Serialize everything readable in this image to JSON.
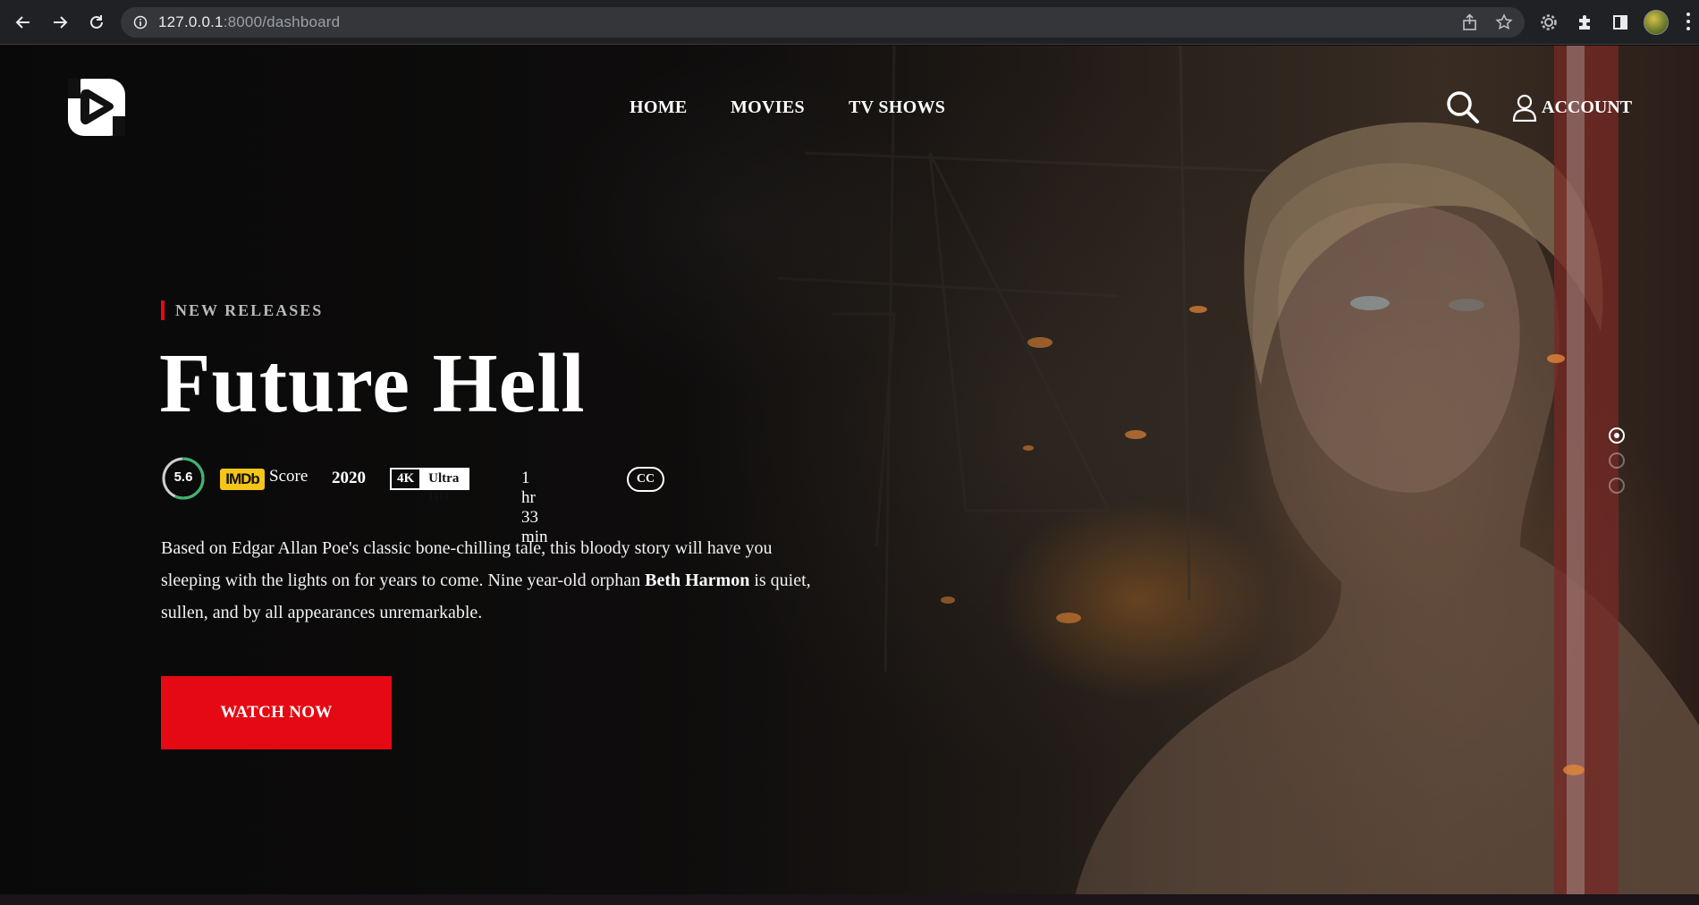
{
  "browser": {
    "url_host": "127.0.0.1",
    "url_rest": ":8000/dashboard"
  },
  "nav": {
    "links": [
      "HOME",
      "MOVIES",
      "TV SHOWS"
    ],
    "account_label": "ACCOUNT"
  },
  "hero": {
    "eyebrow": "NEW RELEASES",
    "title": "Future Hell",
    "rating": "5.6",
    "rating_fraction": 0.56,
    "imdb_badge": "IMDb",
    "imdb_label": "Score",
    "year": "2020",
    "quality_left": "4K",
    "quality_right": "Ultra HD",
    "runtime": "1 hr 33 min",
    "cc": "CC",
    "description_before": "Based on Edgar Allan Poe's classic bone-chilling tale, this bloody story will have you sleeping with the lights on for years to come. Nine year-old orphan ",
    "description_bold": "Beth Harmon",
    "description_after": " is quiet, sullen, and by all appearances unremarkable.",
    "cta_label": "WATCH NOW",
    "slides_total": 3,
    "slide_active": 1
  },
  "colors": {
    "accent": "#e50914",
    "imdb": "#f5c518",
    "rating_ring": "#3cb371"
  }
}
